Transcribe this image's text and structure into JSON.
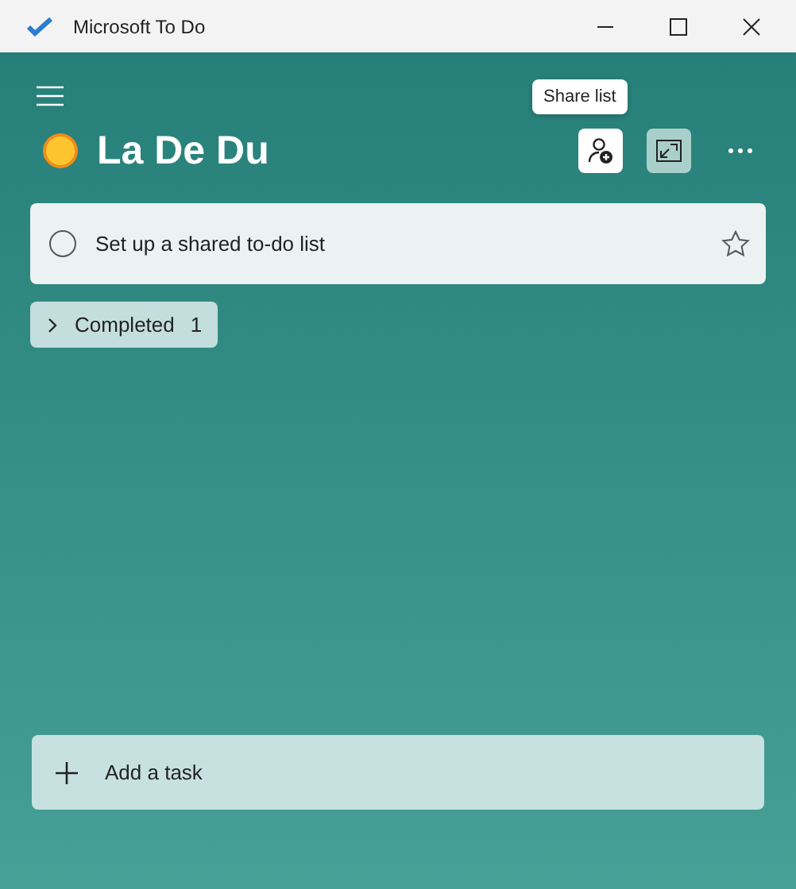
{
  "window": {
    "title": "Microsoft To Do"
  },
  "list": {
    "title": "La De Du",
    "tooltip": "Share list"
  },
  "tasks": [
    {
      "title": "Set up a shared to-do list",
      "completed": false,
      "starred": false
    }
  ],
  "completed_group": {
    "label": "Completed",
    "count": "1",
    "expanded": false
  },
  "add_task": {
    "placeholder": "Add a task"
  }
}
